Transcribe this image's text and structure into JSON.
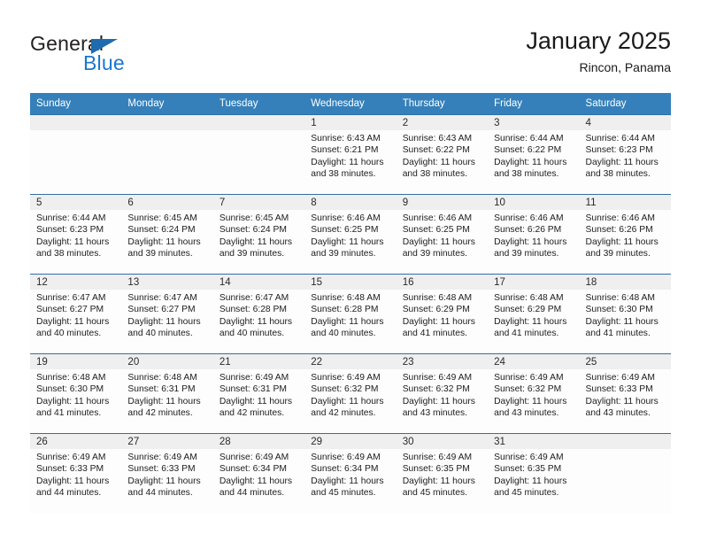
{
  "logo": {
    "word_one": "General",
    "word_two": "Blue",
    "triangle_icon": "blue-triangle-icon",
    "blue_hex": "#1b76d2",
    "triangle_hex": "#1e6bb0"
  },
  "header": {
    "month_title": "January 2025",
    "location": "Rincon, Panama"
  },
  "theme": {
    "header_bg": "#3580ba",
    "daynum_band_bg": "#efefef",
    "row_divider": "#2f6fa6",
    "cell_bg": "#fdfdfd"
  },
  "calendar": {
    "weekday_headers": [
      "Sunday",
      "Monday",
      "Tuesday",
      "Wednesday",
      "Thursday",
      "Friday",
      "Saturday"
    ],
    "weeks": [
      [
        {
          "day": "",
          "sunrise": "",
          "sunset": "",
          "daylight_1": "",
          "daylight_2": ""
        },
        {
          "day": "",
          "sunrise": "",
          "sunset": "",
          "daylight_1": "",
          "daylight_2": ""
        },
        {
          "day": "",
          "sunrise": "",
          "sunset": "",
          "daylight_1": "",
          "daylight_2": ""
        },
        {
          "day": "1",
          "sunrise": "Sunrise: 6:43 AM",
          "sunset": "Sunset: 6:21 PM",
          "daylight_1": "Daylight: 11 hours",
          "daylight_2": "and 38 minutes."
        },
        {
          "day": "2",
          "sunrise": "Sunrise: 6:43 AM",
          "sunset": "Sunset: 6:22 PM",
          "daylight_1": "Daylight: 11 hours",
          "daylight_2": "and 38 minutes."
        },
        {
          "day": "3",
          "sunrise": "Sunrise: 6:44 AM",
          "sunset": "Sunset: 6:22 PM",
          "daylight_1": "Daylight: 11 hours",
          "daylight_2": "and 38 minutes."
        },
        {
          "day": "4",
          "sunrise": "Sunrise: 6:44 AM",
          "sunset": "Sunset: 6:23 PM",
          "daylight_1": "Daylight: 11 hours",
          "daylight_2": "and 38 minutes."
        }
      ],
      [
        {
          "day": "5",
          "sunrise": "Sunrise: 6:44 AM",
          "sunset": "Sunset: 6:23 PM",
          "daylight_1": "Daylight: 11 hours",
          "daylight_2": "and 38 minutes."
        },
        {
          "day": "6",
          "sunrise": "Sunrise: 6:45 AM",
          "sunset": "Sunset: 6:24 PM",
          "daylight_1": "Daylight: 11 hours",
          "daylight_2": "and 39 minutes."
        },
        {
          "day": "7",
          "sunrise": "Sunrise: 6:45 AM",
          "sunset": "Sunset: 6:24 PM",
          "daylight_1": "Daylight: 11 hours",
          "daylight_2": "and 39 minutes."
        },
        {
          "day": "8",
          "sunrise": "Sunrise: 6:46 AM",
          "sunset": "Sunset: 6:25 PM",
          "daylight_1": "Daylight: 11 hours",
          "daylight_2": "and 39 minutes."
        },
        {
          "day": "9",
          "sunrise": "Sunrise: 6:46 AM",
          "sunset": "Sunset: 6:25 PM",
          "daylight_1": "Daylight: 11 hours",
          "daylight_2": "and 39 minutes."
        },
        {
          "day": "10",
          "sunrise": "Sunrise: 6:46 AM",
          "sunset": "Sunset: 6:26 PM",
          "daylight_1": "Daylight: 11 hours",
          "daylight_2": "and 39 minutes."
        },
        {
          "day": "11",
          "sunrise": "Sunrise: 6:46 AM",
          "sunset": "Sunset: 6:26 PM",
          "daylight_1": "Daylight: 11 hours",
          "daylight_2": "and 39 minutes."
        }
      ],
      [
        {
          "day": "12",
          "sunrise": "Sunrise: 6:47 AM",
          "sunset": "Sunset: 6:27 PM",
          "daylight_1": "Daylight: 11 hours",
          "daylight_2": "and 40 minutes."
        },
        {
          "day": "13",
          "sunrise": "Sunrise: 6:47 AM",
          "sunset": "Sunset: 6:27 PM",
          "daylight_1": "Daylight: 11 hours",
          "daylight_2": "and 40 minutes."
        },
        {
          "day": "14",
          "sunrise": "Sunrise: 6:47 AM",
          "sunset": "Sunset: 6:28 PM",
          "daylight_1": "Daylight: 11 hours",
          "daylight_2": "and 40 minutes."
        },
        {
          "day": "15",
          "sunrise": "Sunrise: 6:48 AM",
          "sunset": "Sunset: 6:28 PM",
          "daylight_1": "Daylight: 11 hours",
          "daylight_2": "and 40 minutes."
        },
        {
          "day": "16",
          "sunrise": "Sunrise: 6:48 AM",
          "sunset": "Sunset: 6:29 PM",
          "daylight_1": "Daylight: 11 hours",
          "daylight_2": "and 41 minutes."
        },
        {
          "day": "17",
          "sunrise": "Sunrise: 6:48 AM",
          "sunset": "Sunset: 6:29 PM",
          "daylight_1": "Daylight: 11 hours",
          "daylight_2": "and 41 minutes."
        },
        {
          "day": "18",
          "sunrise": "Sunrise: 6:48 AM",
          "sunset": "Sunset: 6:30 PM",
          "daylight_1": "Daylight: 11 hours",
          "daylight_2": "and 41 minutes."
        }
      ],
      [
        {
          "day": "19",
          "sunrise": "Sunrise: 6:48 AM",
          "sunset": "Sunset: 6:30 PM",
          "daylight_1": "Daylight: 11 hours",
          "daylight_2": "and 41 minutes."
        },
        {
          "day": "20",
          "sunrise": "Sunrise: 6:48 AM",
          "sunset": "Sunset: 6:31 PM",
          "daylight_1": "Daylight: 11 hours",
          "daylight_2": "and 42 minutes."
        },
        {
          "day": "21",
          "sunrise": "Sunrise: 6:49 AM",
          "sunset": "Sunset: 6:31 PM",
          "daylight_1": "Daylight: 11 hours",
          "daylight_2": "and 42 minutes."
        },
        {
          "day": "22",
          "sunrise": "Sunrise: 6:49 AM",
          "sunset": "Sunset: 6:32 PM",
          "daylight_1": "Daylight: 11 hours",
          "daylight_2": "and 42 minutes."
        },
        {
          "day": "23",
          "sunrise": "Sunrise: 6:49 AM",
          "sunset": "Sunset: 6:32 PM",
          "daylight_1": "Daylight: 11 hours",
          "daylight_2": "and 43 minutes."
        },
        {
          "day": "24",
          "sunrise": "Sunrise: 6:49 AM",
          "sunset": "Sunset: 6:32 PM",
          "daylight_1": "Daylight: 11 hours",
          "daylight_2": "and 43 minutes."
        },
        {
          "day": "25",
          "sunrise": "Sunrise: 6:49 AM",
          "sunset": "Sunset: 6:33 PM",
          "daylight_1": "Daylight: 11 hours",
          "daylight_2": "and 43 minutes."
        }
      ],
      [
        {
          "day": "26",
          "sunrise": "Sunrise: 6:49 AM",
          "sunset": "Sunset: 6:33 PM",
          "daylight_1": "Daylight: 11 hours",
          "daylight_2": "and 44 minutes."
        },
        {
          "day": "27",
          "sunrise": "Sunrise: 6:49 AM",
          "sunset": "Sunset: 6:33 PM",
          "daylight_1": "Daylight: 11 hours",
          "daylight_2": "and 44 minutes."
        },
        {
          "day": "28",
          "sunrise": "Sunrise: 6:49 AM",
          "sunset": "Sunset: 6:34 PM",
          "daylight_1": "Daylight: 11 hours",
          "daylight_2": "and 44 minutes."
        },
        {
          "day": "29",
          "sunrise": "Sunrise: 6:49 AM",
          "sunset": "Sunset: 6:34 PM",
          "daylight_1": "Daylight: 11 hours",
          "daylight_2": "and 45 minutes."
        },
        {
          "day": "30",
          "sunrise": "Sunrise: 6:49 AM",
          "sunset": "Sunset: 6:35 PM",
          "daylight_1": "Daylight: 11 hours",
          "daylight_2": "and 45 minutes."
        },
        {
          "day": "31",
          "sunrise": "Sunrise: 6:49 AM",
          "sunset": "Sunset: 6:35 PM",
          "daylight_1": "Daylight: 11 hours",
          "daylight_2": "and 45 minutes."
        },
        {
          "day": "",
          "sunrise": "",
          "sunset": "",
          "daylight_1": "",
          "daylight_2": ""
        }
      ]
    ]
  }
}
